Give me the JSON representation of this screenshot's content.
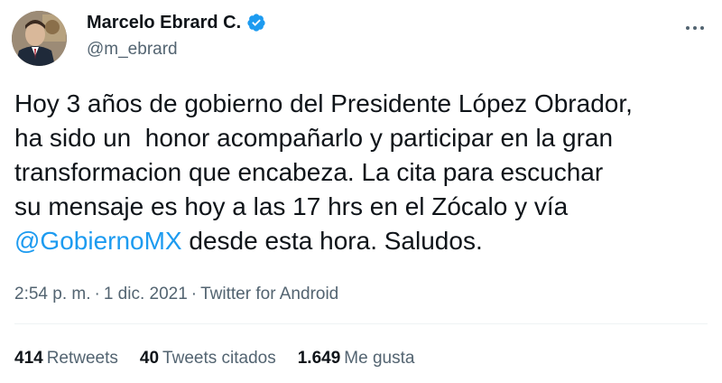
{
  "author": {
    "name": "Marcelo Ebrard C.",
    "handle": "@m_ebrard",
    "verified_color": "#1d9bf0",
    "avatar_icon": "profile-photo"
  },
  "tweet": {
    "lines": [
      "Hoy 3 años de gobierno del Presidente López Obrador,",
      "ha sido un  honor acompañarlo y participar en la gran",
      "transformacion que encabeza. La cita para escuchar",
      "su mensaje es hoy a las 17 hrs en el Zócalo y vía"
    ],
    "mention": "@GobiernoMX",
    "after_mention": " desde esta hora. Saludos."
  },
  "meta": {
    "time": "2:54 p. m.",
    "separator": "·",
    "date": "1 dic. 2021",
    "source": "Twitter for Android"
  },
  "stats": [
    {
      "count": "414",
      "label": "Retweets"
    },
    {
      "count": "40",
      "label": "Tweets citados"
    },
    {
      "count": "1.649",
      "label": "Me gusta"
    }
  ],
  "colors": {
    "link": "#1d9bf0",
    "secondary_text": "#536471"
  }
}
